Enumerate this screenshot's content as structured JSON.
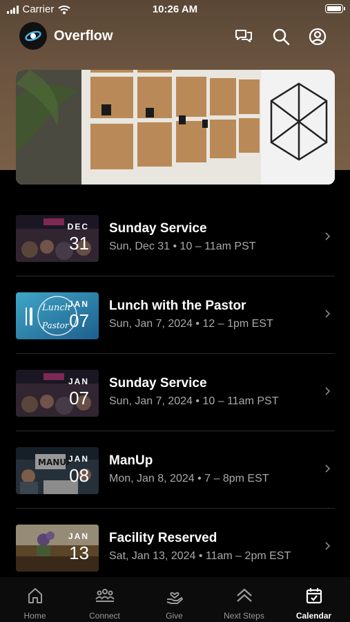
{
  "status_bar": {
    "carrier": "Carrier",
    "time": "10:26 AM"
  },
  "header": {
    "app_name": "Overflow"
  },
  "events": [
    {
      "title": "Sunday Service",
      "subtitle": "Sun, Dec 31 • 10 – 11am PST",
      "month": "DEC",
      "day": "31"
    },
    {
      "title": "Lunch with the Pastor",
      "subtitle": "Sun, Jan 7, 2024 • 12 – 1pm EST",
      "month": "JAN",
      "day": "07"
    },
    {
      "title": "Sunday Service",
      "subtitle": "Sun, Jan 7, 2024 • 10 – 11am PST",
      "month": "JAN",
      "day": "07"
    },
    {
      "title": "ManUp",
      "subtitle": "Mon, Jan 8, 2024 • 7 – 8pm EST",
      "month": "JAN",
      "day": "08"
    },
    {
      "title": "Facility Reserved",
      "subtitle": "Sat, Jan 13, 2024 • 11am – 2pm EST",
      "month": "JAN",
      "day": "13"
    }
  ],
  "thumb_texts": {
    "lunch_line1": "Lunch",
    "lunch_line2": "Pastor",
    "manup": "MANUP"
  },
  "tabs": [
    {
      "label": "Home",
      "icon": "home-icon"
    },
    {
      "label": "Connect",
      "icon": "people-icon"
    },
    {
      "label": "Give",
      "icon": "give-hand-icon"
    },
    {
      "label": "Next Steps",
      "icon": "chevrons-up-icon"
    },
    {
      "label": "Calendar",
      "icon": "calendar-icon",
      "active": true
    }
  ]
}
